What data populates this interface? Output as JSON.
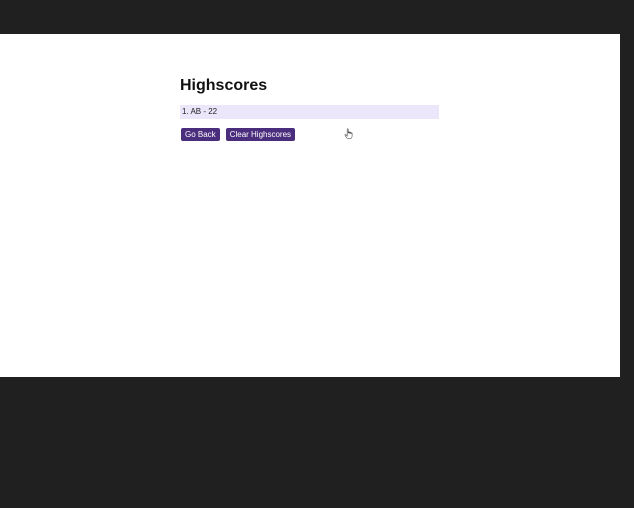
{
  "page": {
    "title": "Highscores"
  },
  "scores": [
    {
      "text": "1. AB - 22"
    }
  ],
  "buttons": {
    "go_back": "Go Back",
    "clear": "Clear Highscores"
  },
  "colors": {
    "button": "#4b2d7d",
    "row": "#ece6fb",
    "outer": "#202020"
  },
  "icons": {
    "cursor": "hand-pointer-icon"
  }
}
